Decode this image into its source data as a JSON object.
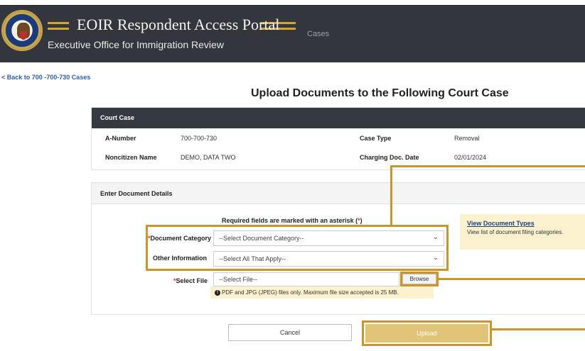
{
  "header": {
    "title": "EOIR Respondent Access Portal",
    "subtitle": "Executive Office for Immigration Review",
    "nav_cases": "Cases",
    "seal_icon": "doj-seal-icon"
  },
  "back_link": "< Back to 700 -700-730 Cases",
  "page_title": "Upload Documents to the Following Court Case",
  "court_case": {
    "heading": "Court Case",
    "a_number_label": "A-Number",
    "a_number_value": "700-700-730",
    "noncitizen_label": "Noncitizen Name",
    "noncitizen_value": "DEMO, DATA TWO",
    "case_type_label": "Case Type",
    "case_type_value": "Removal",
    "charging_label": "Charging Doc. Date",
    "charging_value": "02/01/2024"
  },
  "details": {
    "heading": "Enter Document Details",
    "required_prefix": "Required fields are marked with an asterisk (",
    "required_star": "*",
    "required_suffix": ")",
    "category_label": "Document Category",
    "category_value": "--Select Document Category--",
    "other_label": "Other Information",
    "other_value": "--Select All That Apply--",
    "file_label": "Select File",
    "file_value": "--Select File--",
    "browse_label": "Browse",
    "hint_text": "PDF and JPG (JPEG) files only. Maximum file size accepted is 25 MB.",
    "doc_types_link": "View Document Types",
    "doc_types_desc": "View list of document filing categories."
  },
  "buttons": {
    "cancel": "Cancel",
    "upload": "Upload"
  },
  "colors": {
    "header_bg": "#33373d",
    "accent_gold": "#c9962a",
    "upload_bg": "#e2c479",
    "required_red": "#d0312d"
  }
}
